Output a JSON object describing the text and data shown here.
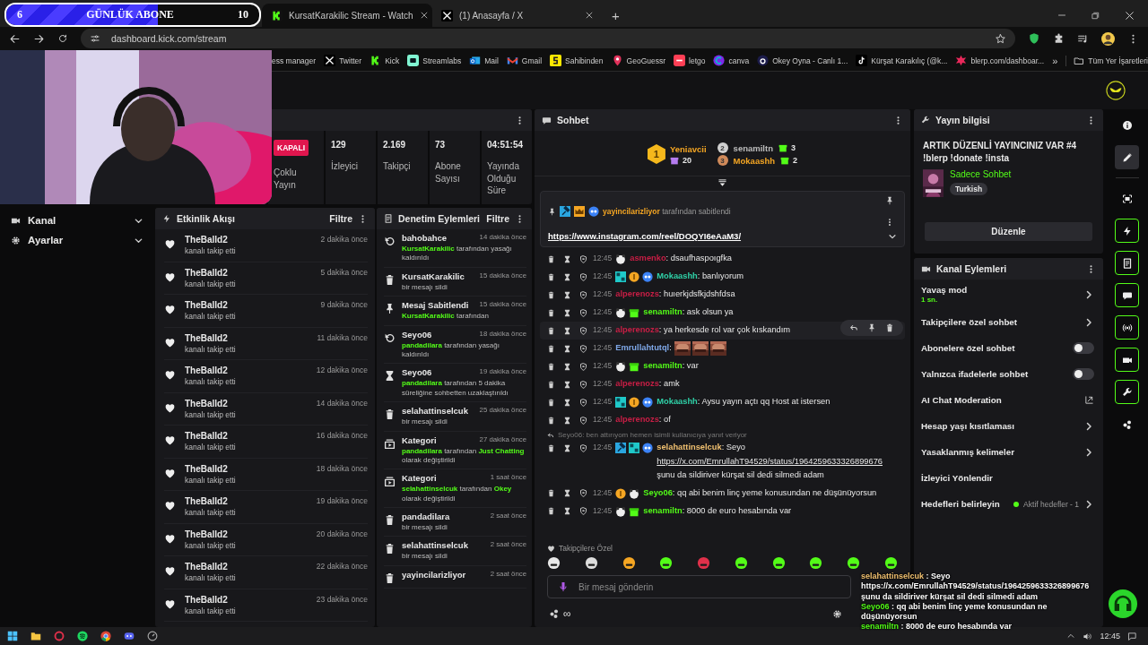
{
  "goal_overlay": {
    "current": "6",
    "title": "GÜNLÜK ABONE",
    "target": "10",
    "level": 0.6
  },
  "browser": {
    "tabs": [
      {
        "title": "KursatKarakilic Stream - Watch",
        "kind": "kick",
        "selected": true
      },
      {
        "title": "(1) Anasayfa / X",
        "kind": "x",
        "selected": false
      }
    ],
    "new_tab": "+",
    "address": "dashboard.kick.com/stream",
    "bookmarks": [
      {
        "label": "ess manager",
        "kind": "none"
      },
      {
        "label": "Twitter",
        "kind": "x"
      },
      {
        "label": "Kick",
        "kind": "kick"
      },
      {
        "label": "Streamlabs",
        "kind": "streamlabs"
      },
      {
        "label": "Mail",
        "kind": "mail"
      },
      {
        "label": "Gmail",
        "kind": "gmail"
      },
      {
        "label": "Sahibinden",
        "kind": "sahibinden"
      },
      {
        "label": "GeoGuessr",
        "kind": "pin"
      },
      {
        "label": "letgo",
        "kind": "letgo"
      },
      {
        "label": "canva",
        "kind": "canva"
      },
      {
        "label": "Okey Oyna - Canlı 1...",
        "kind": "okey"
      },
      {
        "label": "Kürşat Karakılıç (@k...",
        "kind": "tiktok"
      },
      {
        "label": "blerp.com/dashboar...",
        "kind": "blerp"
      }
    ],
    "more": "»",
    "all_bookmarks": "Tüm Yer İşaretleri"
  },
  "nav": [
    {
      "label": "Kanal",
      "kind": "video"
    },
    {
      "label": "Ayarlar",
      "kind": "gear"
    }
  ],
  "stats": {
    "status": "KAPALI",
    "status_label": "Çoklu Yayın",
    "items": [
      {
        "value": "129",
        "label": "İzleyici"
      },
      {
        "value": "2.169",
        "label": "Takipçi"
      },
      {
        "value": "73",
        "label": "Abone Sayısı"
      },
      {
        "value": "04:51:54",
        "label": "Yayında Olduğu Süre"
      }
    ]
  },
  "events": {
    "title": "Etkinlik Akışı",
    "filter": "Filtre",
    "rows": [
      {
        "user": "TheBalld2",
        "action": "kanalı takip etti",
        "time": "2 dakika önce"
      },
      {
        "user": "TheBalld2",
        "action": "kanalı takip etti",
        "time": "5 dakika önce"
      },
      {
        "user": "TheBalld2",
        "action": "kanalı takip etti",
        "time": "9 dakika önce"
      },
      {
        "user": "TheBalld2",
        "action": "kanalı takip etti",
        "time": "11 dakika önce"
      },
      {
        "user": "TheBalld2",
        "action": "kanalı takip etti",
        "time": "12 dakika önce"
      },
      {
        "user": "TheBalld2",
        "action": "kanalı takip etti",
        "time": "14 dakika önce"
      },
      {
        "user": "TheBalld2",
        "action": "kanalı takip etti",
        "time": "16 dakika önce"
      },
      {
        "user": "TheBalld2",
        "action": "kanalı takip etti",
        "time": "18 dakika önce"
      },
      {
        "user": "TheBalld2",
        "action": "kanalı takip etti",
        "time": "19 dakika önce"
      },
      {
        "user": "TheBalld2",
        "action": "kanalı takip etti",
        "time": "20 dakika önce"
      },
      {
        "user": "TheBalld2",
        "action": "kanalı takip etti",
        "time": "22 dakika önce"
      },
      {
        "user": "TheBalld2",
        "action": "kanalı takip etti",
        "time": "23 dakika önce"
      }
    ]
  },
  "moderation": {
    "title": "Denetim Eylemleri",
    "filter": "Filtre",
    "rows": [
      {
        "kind": "unban",
        "title": "bahobahce",
        "time": "14 dakika önce",
        "detail": "**KursatKarakilic** tarafından yasağı kaldırıldı"
      },
      {
        "kind": "delete",
        "title": "KursatKarakilic",
        "time": "15 dakika önce",
        "detail": "bir mesajı sildi"
      },
      {
        "kind": "pin",
        "title": "Mesaj Sabitlendi",
        "time": "15 dakika önce",
        "detail": "**KursatKarakilic** tarafından"
      },
      {
        "kind": "unban",
        "title": "Seyo06",
        "time": "18 dakika önce",
        "detail": "**pandadilara** tarafından yasağı kaldırıldı"
      },
      {
        "kind": "timeout",
        "title": "Seyo06",
        "time": "19 dakika önce",
        "detail": "**pandadilara** tarafından 5 dakika süreliğine sohbetten uzaklaştırıldı"
      },
      {
        "kind": "delete",
        "title": "selahattinselcuk",
        "time": "25 dakika önce",
        "detail": "bir mesajı sildi"
      },
      {
        "kind": "category",
        "title": "Kategori",
        "time": "27 dakika önce",
        "detail": "**pandadilara** tarafından **Just Chatting** olarak değiştirildi"
      },
      {
        "kind": "category",
        "title": "Kategori",
        "time": "1 saat önce",
        "detail": "**selahattinselcuk** tarafından **Okey** olarak değiştirildi"
      },
      {
        "kind": "delete",
        "title": "pandadilara",
        "time": "2 saat önce",
        "detail": "bir mesajı sildi"
      },
      {
        "kind": "delete",
        "title": "selahattinselcuk",
        "time": "2 saat önce",
        "detail": "bir mesajı sildi"
      },
      {
        "kind": "delete",
        "title": "yayincilarizliyor",
        "time": "2 saat önce"
      }
    ]
  },
  "chat": {
    "title": "Sohbet",
    "leaderboard": [
      {
        "rank": "1",
        "user": "Yeniavcii",
        "count": "20"
      },
      {
        "rank": "2",
        "user": "senamiltn",
        "count": "3"
      },
      {
        "rank": "3",
        "user": "Mokaashh",
        "count": "2"
      }
    ],
    "pinned": {
      "by": "yayincilarizliyor",
      "by_suffix": "tarafından sabitlendi",
      "link": "https://www.instagram.com/reel/DOQYI6eAaM3/"
    },
    "messages": [
      {
        "time": "12:45",
        "badges": [
          {
            "kind": "panda"
          }
        ],
        "user": "asmenko",
        "color": "#c81e45",
        "text": ": dsaufhaspoıgfka",
        "hovered": false
      },
      {
        "time": "12:45",
        "badges": [
          {
            "kind": "tile"
          },
          {
            "kind": "coin"
          },
          {
            "kind": "bot"
          }
        ],
        "user": "Mokaashh",
        "color": "#2fd1a8",
        "text": ": banlıyorum",
        "hovered": false
      },
      {
        "time": "12:45",
        "user": "alperenozs",
        "color": "#c81e45",
        "text": ": huıerkjdsfkjdshfdsa",
        "hovered": false
      },
      {
        "time": "12:45",
        "badges": [
          {
            "kind": "panda"
          },
          {
            "kind": "gift"
          }
        ],
        "user": "senamiltn",
        "color": "#53fc18",
        "text": ": ask olsun ya",
        "hovered": false
      },
      {
        "time": "12:45",
        "user": "alperenozs",
        "color": "#c81e45",
        "text": ": ya herkesde rol var çok kıskandım",
        "hovered": true
      },
      {
        "time": "12:45",
        "user": "Emrullahtutql",
        "color": "#7fa8e8",
        "text": ":",
        "hovered": false
      },
      {
        "time": "12:45",
        "badges": [
          {
            "kind": "panda"
          },
          {
            "kind": "gift"
          }
        ],
        "user": "senamiltn",
        "color": "#53fc18",
        "text": ": var",
        "hovered": false
      },
      {
        "time": "12:45",
        "user": "alperenozs",
        "color": "#c81e45",
        "text": ": amk",
        "hovered": false
      },
      {
        "time": "12:45",
        "badges": [
          {
            "kind": "tile"
          },
          {
            "kind": "coin"
          },
          {
            "kind": "bot"
          }
        ],
        "user": "Mokaashh",
        "color": "#2fd1a8",
        "text": ": Aysu yayın açtı qq Host at istersen",
        "hovered": false
      },
      {
        "time": "12:45",
        "user": "alperenozs",
        "color": "#c81e45",
        "text": ": of",
        "hovered": false
      },
      {
        "reply": "Seyo06: ben attırıyom hemen isimli kullanıcıya yanıt veriyor",
        "time": "12:45",
        "badges": [
          {
            "kind": "hammer"
          },
          {
            "kind": "tile"
          },
          {
            "kind": "bot"
          }
        ],
        "user": "selahattinselcuk",
        "color": "#f0c070",
        "text": ": Seyo ",
        "link": "https://x.com/EmrullahT94529/status/1964259633326899676",
        "text_after": " şunu da sildiriver kürşat sil dedi silmedi adam",
        "hovered": false
      },
      {
        "time": "12:45",
        "badges": [
          {
            "kind": "coin"
          },
          {
            "kind": "panda"
          }
        ],
        "user": "Seyo06",
        "color": "#53fc18",
        "text": ": qq abi benim linç yeme konusundan ne düşünüyorsun",
        "hovered": false
      },
      {
        "time": "12:45",
        "badges": [
          {
            "kind": "panda"
          },
          {
            "kind": "gift"
          }
        ],
        "user": "senamiltn",
        "color": "#53fc18",
        "text": ": 8000 de euro hesabında var",
        "hovered": false
      }
    ],
    "emote_label": "Takipçilere Özel",
    "input_placeholder": "Bir mesaj gönderin",
    "footer_symbol": "∞"
  },
  "stream_info": {
    "title": "Yayın bilgisi",
    "stream_title": "ARTIK DÜZENLİ YAYINCINIZ VAR #4 !blerp !donate !insta",
    "category": "Sadece Sohbet",
    "tag": "Turkish",
    "edit": "Düzenle"
  },
  "channel_actions": {
    "title": "Kanal Eylemleri",
    "rows": [
      {
        "kind": "link",
        "label": "Yavaş mod",
        "sub": "1 sn."
      },
      {
        "kind": "link",
        "label": "Takipçilere özel sohbet"
      },
      {
        "kind": "toggle",
        "label": "Abonelere özel sohbet",
        "on": false
      },
      {
        "kind": "toggle",
        "label": "Yalnızca ifadelerle sohbet",
        "on": false
      },
      {
        "kind": "external",
        "label": "AI Chat Moderation"
      },
      {
        "kind": "link",
        "label": "Hesap yaşı kısıtlaması"
      },
      {
        "kind": "link",
        "label": "Yasaklanmış kelimeler"
      },
      {
        "kind": "plain",
        "label": "İzleyici Yönlendir"
      },
      {
        "kind": "goal",
        "label": "Hedefleri belirleyin",
        "goal": "Aktif hedefler - 1"
      }
    ]
  },
  "rail": [
    {
      "kind": "info",
      "selected": false,
      "active": false
    },
    {
      "kind": "pencil",
      "selected": true,
      "active": false
    },
    {
      "kind": "frame",
      "selected": false,
      "active": false
    },
    {
      "kind": "bolt",
      "selected": false,
      "active": true
    },
    {
      "kind": "doc",
      "selected": false,
      "active": true
    },
    {
      "kind": "chat",
      "selected": false,
      "active": true
    },
    {
      "kind": "broadcast",
      "selected": false,
      "active": true
    },
    {
      "kind": "camera",
      "selected": false,
      "active": true
    },
    {
      "kind": "wrench",
      "selected": false,
      "active": true
    },
    {
      "kind": "cluster",
      "selected": false,
      "active": false
    }
  ],
  "stream_overlay": [
    {
      "user": "selahattinselcuk",
      "color": "#f0c070",
      "text": " : Seyo https://x.com/EmrullahT94529/status/1964259633326899676 şunu da sildiriver kürşat sil dedi silmedi adam"
    },
    {
      "user": "Seyo06",
      "color": "#53fc18",
      "text": " : qq abi benim linç yeme konusundan ne düşünüyorsun"
    },
    {
      "user": "senamiltn",
      "color": "#53fc18",
      "text": " : 8000 de euro hesabında var"
    }
  ],
  "taskbar": {
    "time": "12:45"
  }
}
